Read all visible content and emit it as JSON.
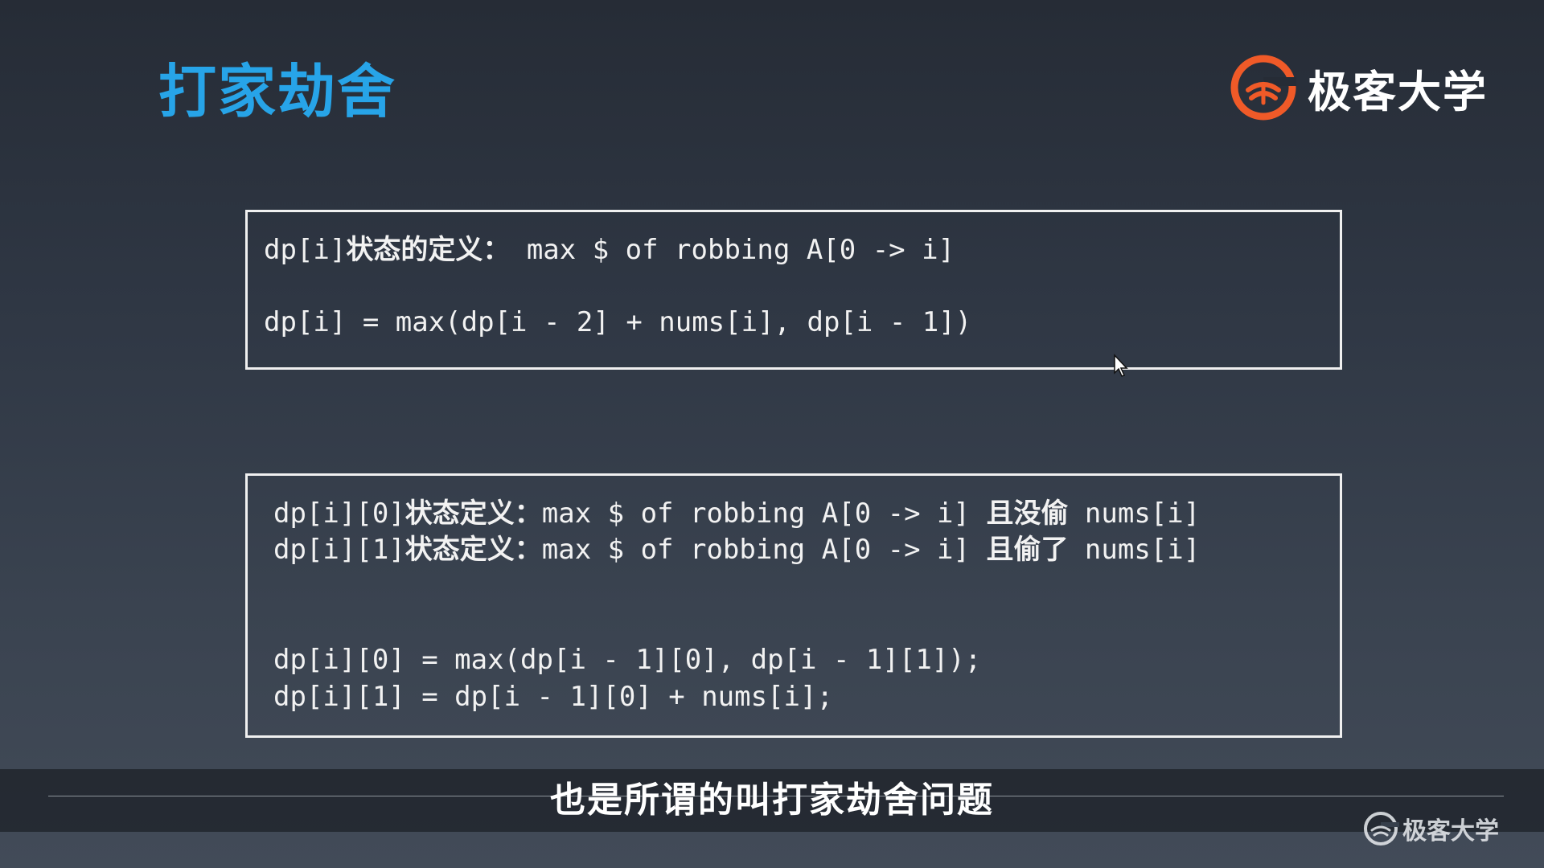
{
  "slide": {
    "title": "打家劫舍"
  },
  "brand": {
    "logo_icon": "geekbang-logo-icon",
    "name": "极客大学",
    "accent_color": "#f05a28"
  },
  "box1": {
    "line1": {
      "prefix": "dp[i]",
      "label": "状态的定义：",
      "text": " max $ of robbing A[0 -> i]"
    },
    "line2": "dp[i] = max(dp[i - 2] + nums[i], dp[i - 1])"
  },
  "box2": {
    "def1": {
      "prefix": "dp[i][0]",
      "label": "状态定义：",
      "text": "max $ of robbing A[0 -> i] ",
      "note": "且没偷",
      "suffix": " nums[i]"
    },
    "def2": {
      "prefix": "dp[i][1]",
      "label": "状态定义：",
      "text": "max $ of robbing A[0 -> i] ",
      "note": "且偷了",
      "suffix": " nums[i]"
    },
    "eq1": "dp[i][0] = max(dp[i - 1][0], dp[i - 1][1]);",
    "eq2": "dp[i][1] = dp[i - 1][0] + nums[i];"
  },
  "caption": {
    "subtitle": "也是所谓的叫打家劫舍问题"
  },
  "watermark": {
    "logo_icon": "geekbang-logo-icon",
    "name": "极客大学"
  }
}
